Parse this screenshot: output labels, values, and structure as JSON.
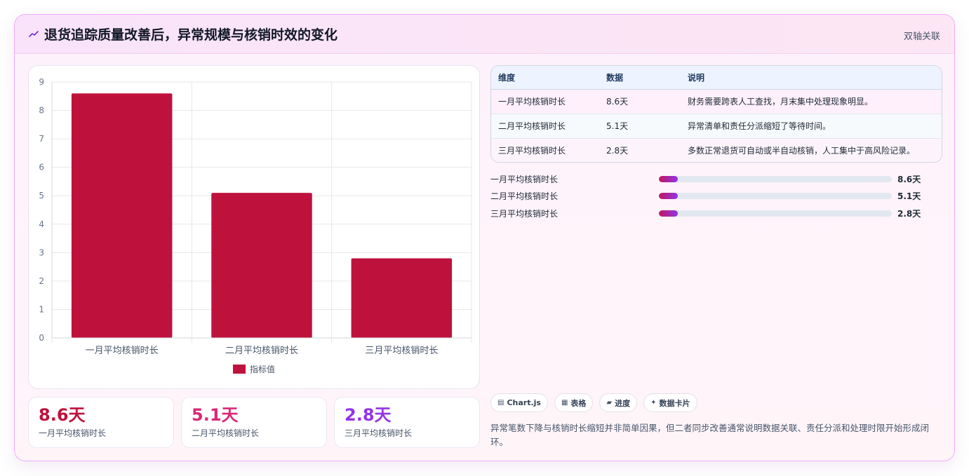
{
  "header": {
    "icon": "trend-line-icon",
    "title": "退货追踪质量改善后，异常规模与核销时效的变化",
    "tag": "双轴关联"
  },
  "chart_data": {
    "type": "bar",
    "categories": [
      "一月平均核销时长",
      "二月平均核销时长",
      "三月平均核销时长"
    ],
    "series": [
      {
        "name": "指标值",
        "values": [
          8.6,
          5.1,
          2.8
        ],
        "color": "#be123c"
      }
    ],
    "yticks": [
      "0",
      "1",
      "2",
      "3",
      "4",
      "5",
      "6",
      "7",
      "8",
      "9"
    ],
    "ylim": [
      0,
      9
    ],
    "legend": "bottom",
    "grid": true
  },
  "stats": [
    {
      "value": "8.6天",
      "label": "一月平均核销时长",
      "color": "#be123c"
    },
    {
      "value": "5.1天",
      "label": "二月平均核销时长",
      "color": "#db2777"
    },
    {
      "value": "2.8天",
      "label": "三月平均核销时长",
      "color": "#9333ea"
    }
  ],
  "table": {
    "headers": [
      "维度",
      "数据",
      "说明"
    ],
    "rows": [
      [
        "一月平均核销时长",
        "8.6天",
        "财务需要跨表人工查找，月末集中处理现象明显。"
      ],
      [
        "二月平均核销时长",
        "5.1天",
        "异常清单和责任分派缩短了等待时间。"
      ],
      [
        "三月平均核销时长",
        "2.8天",
        "多数正常退货可自动或半自动核销，人工集中于高风险记录。"
      ]
    ]
  },
  "progress": [
    {
      "label": "一月平均核销时长",
      "value": "8.6天",
      "fraction": 0.08
    },
    {
      "label": "二月平均核销时长",
      "value": "5.1天",
      "fraction": 0.08
    },
    {
      "label": "三月平均核销时长",
      "value": "2.8天",
      "fraction": 0.08
    }
  ],
  "chips": [
    {
      "icon": "chart-icon",
      "glyph": "▤",
      "label": "Chart.js"
    },
    {
      "icon": "table-icon",
      "glyph": "▦",
      "label": "表格"
    },
    {
      "icon": "progress-icon",
      "glyph": "▰",
      "label": "进度"
    },
    {
      "icon": "sparkle-icon",
      "glyph": "✦",
      "label": "数据卡片"
    }
  ],
  "note": "异常笔数下降与核销时长缩短并非简单因果，但二者同步改善通常说明数据关联、责任分派和处理时限开始形成闭环。"
}
